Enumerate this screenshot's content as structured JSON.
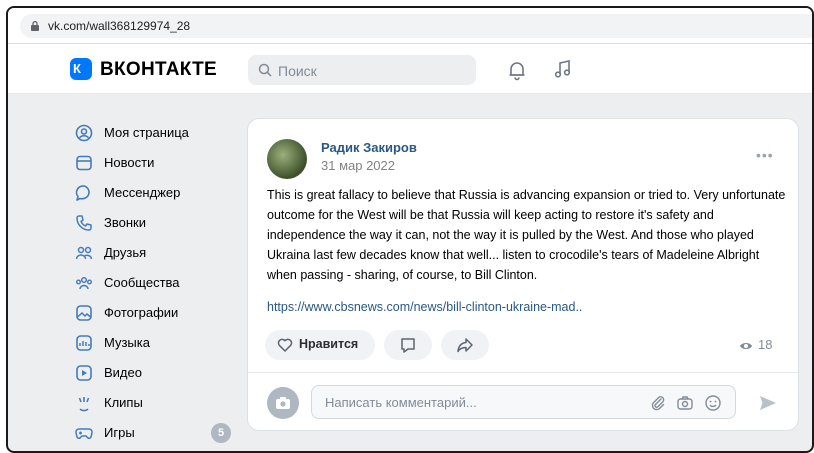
{
  "browser": {
    "url": "vk.com/wall368129974_28"
  },
  "header": {
    "logo_letter": "К",
    "logo_text": "ВКОНТАКТЕ",
    "search_placeholder": "Поиск",
    "icons": [
      "bell-icon",
      "music-icon"
    ]
  },
  "sidebar": {
    "items": [
      {
        "label": "Моя страница",
        "icon": "profile-icon"
      },
      {
        "label": "Новости",
        "icon": "news-icon"
      },
      {
        "label": "Мессенджер",
        "icon": "messenger-icon"
      },
      {
        "label": "Звонки",
        "icon": "phone-icon"
      },
      {
        "label": "Друзья",
        "icon": "friends-icon"
      },
      {
        "label": "Сообщества",
        "icon": "communities-icon"
      },
      {
        "label": "Фотографии",
        "icon": "photos-icon"
      },
      {
        "label": "Музыка",
        "icon": "music-icon"
      },
      {
        "label": "Видео",
        "icon": "video-icon"
      },
      {
        "label": "Клипы",
        "icon": "clips-icon"
      },
      {
        "label": "Игры",
        "icon": "games-icon",
        "badge": "5"
      }
    ]
  },
  "post": {
    "author": "Радик Закиров",
    "date": "31 мар 2022",
    "text": "This is great fallacy to believe that Russia is advancing expansion or tried to. Very unfortunate outcome for the West will be that Russia will keep acting to restore it's safety and independence the way it can, not the way it is pulled by the West. And those who played Ukraina last few decades know that well... listen to crocodile's tears of Madeleine Albright when passing - sharing, of course, to Bill Clinton.",
    "link": "https://www.cbsnews.com/news/bill-clinton-ukraine-mad..",
    "like_label": "Нравится",
    "views": "18"
  },
  "comment": {
    "placeholder": "Написать комментарий..."
  },
  "colors": {
    "brand": "#0077ff",
    "link": "#2a5885",
    "background": "#edeef0"
  }
}
